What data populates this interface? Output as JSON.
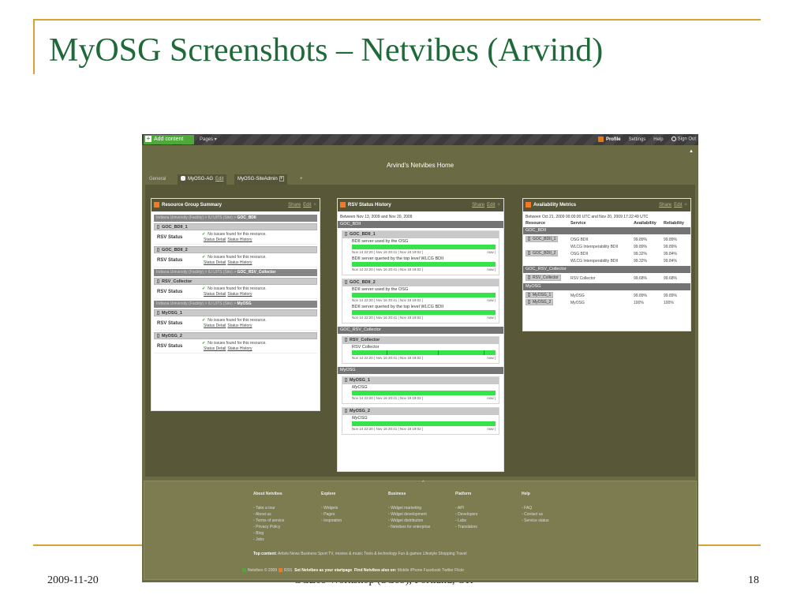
{
  "slide": {
    "title": "MyOSG Screenshots – Netvibes (Arvind)",
    "date": "2009-11-20",
    "event": "GCE09 Workshop (SC09), Portland, OR",
    "page_number": "18"
  },
  "netvibes": {
    "topbar": {
      "add_content": "Add content",
      "pages_menu": "Pages ▾",
      "profile": "Profile",
      "settings": "Settings",
      "help": "Help",
      "sign_out": "Sign Out"
    },
    "home_title": "Arvind's Netvibes Home",
    "tabs": {
      "general": "General",
      "myosg_ag": "MyOSG-AG",
      "myosg_ag_edit": "Edit",
      "siteadmin": "MyOSG-SiteAdmin",
      "add": "+"
    },
    "widget_actions": {
      "share": "Share",
      "edit": "Edit",
      "close": "×"
    },
    "rgs": {
      "title": "Resource Group Summary",
      "status_label": "RSV Status",
      "no_issues": "No issues found for this resource.",
      "status_detail": "Status Detail",
      "status_history": "Status History",
      "groups": [
        {
          "crumb_prefix": "Indiana University (Facility) > IU UITS (Site) > ",
          "crumb_name": "GOC_BDII",
          "resources": [
            "GOC_BDII_1",
            "GOC_BDII_2"
          ]
        },
        {
          "crumb_prefix": "Indiana University (Facility) > IU UITS (Site) > ",
          "crumb_name": "GOC_RSV_Collector",
          "resources": [
            "RSV_Collector"
          ]
        },
        {
          "crumb_prefix": "Indiana University (Facility) > IU UITS (Site) > ",
          "crumb_name": "MyOSG",
          "resources": [
            "MyOSG_1",
            "MyOSG_2"
          ]
        }
      ]
    },
    "rsh": {
      "title": "RSV Status History",
      "range": "Between Nov 13, 2009 and Nov 20, 2009",
      "scale": "Nov 14 22:20 |   Nov 16 20:41 |   Nov 18 19:02 |",
      "now": "now |",
      "groups": [
        {
          "name": "GOC_BDII",
          "resources": [
            {
              "name": "GOC_BDII_1",
              "italic": false,
              "services": [
                "BDII server used by the OSG",
                "BDII server queried by the top level WLCG BDII"
              ]
            },
            {
              "name": "GOC_BDII_2",
              "italic": false,
              "services": [
                "BDII server used by the OSG",
                "BDII server queried by the top level WLCG BDII"
              ]
            }
          ]
        },
        {
          "name": "GOC_RSV_Collector",
          "resources": [
            {
              "name": "RSV_Collector",
              "italic": false,
              "services": [
                "RSV Collector"
              ]
            }
          ]
        },
        {
          "name": "MyOSG",
          "resources": [
            {
              "name": "MyOSG_1",
              "italic": true,
              "services": [
                "MyOSG"
              ]
            },
            {
              "name": "MyOSG_2",
              "italic": true,
              "services": [
                "MyOSG"
              ]
            }
          ]
        }
      ]
    },
    "am": {
      "title": "Availability Metrics",
      "range": "Between Oct 21, 2009 00:00:00 UTC and Nov 20, 2009 17:22:49 UTC",
      "headers": [
        "Resource",
        "Service",
        "Availability",
        "Reliability"
      ],
      "groups": [
        {
          "name": "GOC_BDII",
          "rows": [
            {
              "resource": "GOC_BDII_1",
              "service": "OSG BDII",
              "availability": "99.89%",
              "reliability": "99.89%"
            },
            {
              "resource": "",
              "service": "WLCG Interoperability BDII",
              "availability": "99.89%",
              "reliability": "99.89%"
            },
            {
              "resource": "GOC_BDII_2",
              "service": "OSG BDII",
              "availability": "99.32%",
              "reliability": "99.84%"
            },
            {
              "resource": "",
              "service": "WLCG Interoperability BDII",
              "availability": "99.32%",
              "reliability": "99.84%"
            }
          ]
        },
        {
          "name": "GOC_RSV_Collector",
          "rows": [
            {
              "resource": "RSV_Collector",
              "service": "RSV Collector",
              "availability": "99.68%",
              "reliability": "99.68%"
            }
          ]
        },
        {
          "name": "MyOSG",
          "rows": [
            {
              "resource": "MyOSG_1",
              "service": "MyOSG",
              "availability": "99.89%",
              "reliability": "99.89%"
            },
            {
              "resource": "MyOSG_2",
              "service": "MyOSG",
              "availability": "100%",
              "reliability": "100%"
            }
          ]
        }
      ]
    },
    "footer": {
      "columns": [
        {
          "title": "About Netvibes",
          "items": [
            "Take a tour",
            "About us",
            "Terms of service",
            "Privacy Policy",
            "Blog",
            "Jobs"
          ]
        },
        {
          "title": "Explore",
          "items": [
            "Widgets",
            "Pages",
            "Inspiration"
          ]
        },
        {
          "title": "Business",
          "items": [
            "Widget marketing",
            "Widget development",
            "Widget distribution",
            "Netvibes for enterprise"
          ]
        },
        {
          "title": "Platform",
          "items": [
            "API",
            "Developers",
            "Labs",
            "Translators"
          ]
        },
        {
          "title": "Help",
          "items": [
            "FAQ",
            "Contact us",
            "Service status"
          ]
        }
      ],
      "top_content_label": "Top content:",
      "top_content": "Artists  News  Business  Sport  TV, movies & music  Tools & technology  Fun & games  Lifestyle  Shopping  Travel",
      "copyright": "Netvibes © 2009",
      "rss": "RSS",
      "set_startpage": "Set Netvibes as your startpage",
      "find_label": "Find Netvibes also on:",
      "find_links": "Mobile  iPhone  Facebook  Twitter  Flickr"
    }
  }
}
